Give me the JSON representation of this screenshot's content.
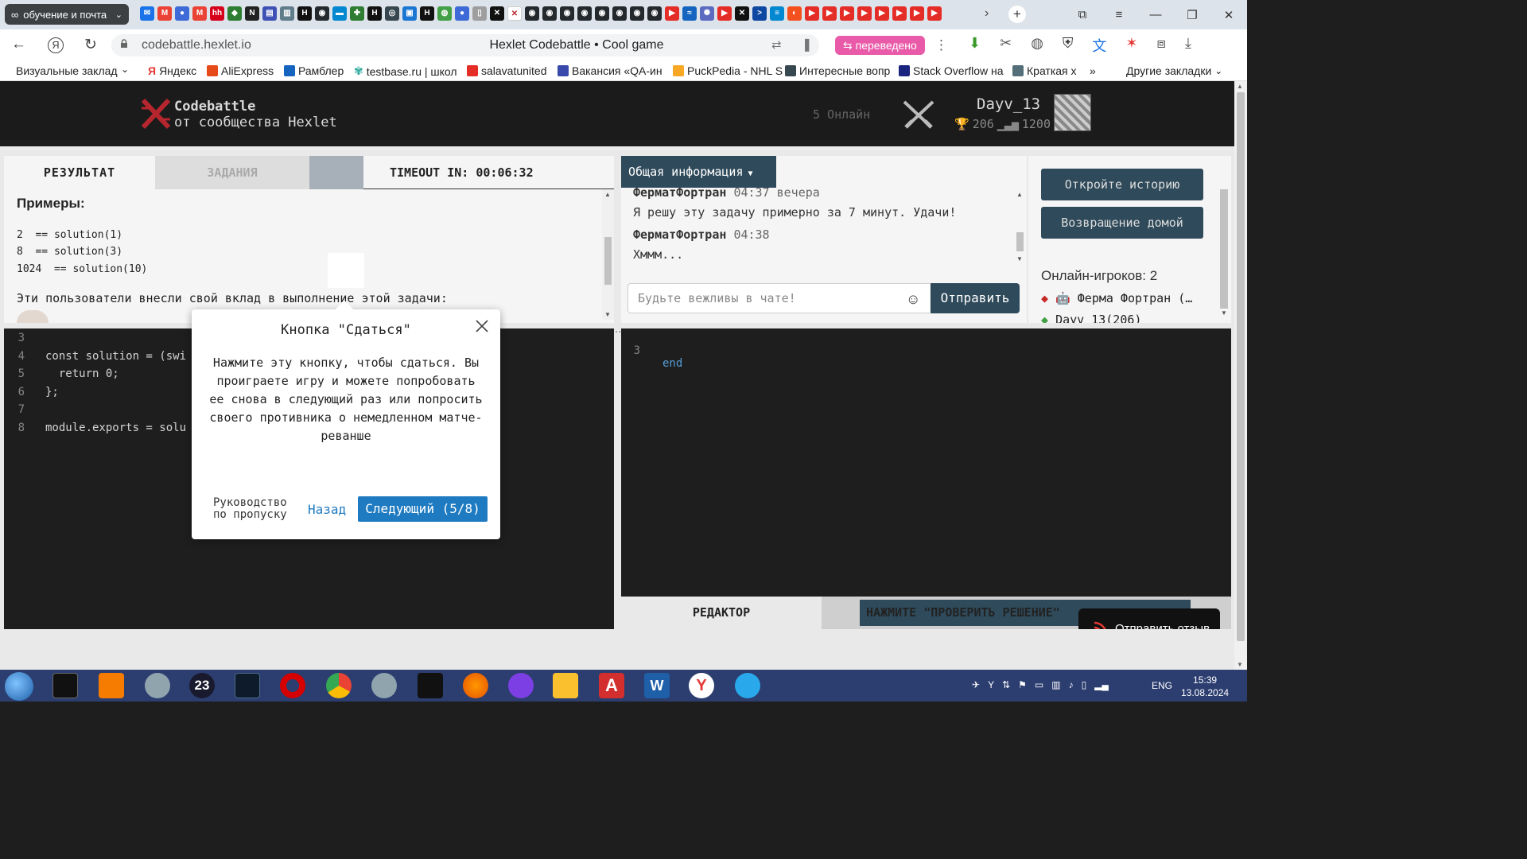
{
  "browser": {
    "tab_group_label": "обучение и почта",
    "url": "codebattle.hexlet.io",
    "page_title": "Hexlet Codebattle • Cool game",
    "translated_badge": "переведено",
    "bookmarks": [
      "Визуальные заклад",
      "Яндекс",
      "AliExpress",
      "Рамблер",
      "testbase.ru | школ",
      "salavatunited",
      "Вакансия «QA-ин",
      "PuckPedia - NHL S",
      "Интересные вопр",
      "Stack Overflow на",
      "Краткая х"
    ],
    "other_bookmarks": "Другие закладки",
    "more_bookmarks": "»"
  },
  "header": {
    "brand_line1": "Codebattle",
    "brand_line2": "от сообщества Hexlet",
    "online": "5 Онлайн",
    "user_name": "Dayv_13",
    "user_rank": "206",
    "user_rating": "1200"
  },
  "task_panel": {
    "tab_result": "РЕЗУЛЬТАТ",
    "tab_tasks": "ЗАДАНИЯ",
    "timeout": "TIMEOUT IN: 00:06:32",
    "examples_title": "Примеры:",
    "examples": [
      "2  == solution(1)",
      "8  == solution(3)",
      "1024  == solution(10)"
    ],
    "contributors": "Эти пользователи внесли свой вклад в выполнение этой задачи:"
  },
  "left_editor": {
    "lines": [
      {
        "n": "3",
        "code": ""
      },
      {
        "n": "4",
        "code": "const solution = (swi"
      },
      {
        "n": "5",
        "code": "  return 0;"
      },
      {
        "n": "6",
        "code": "};"
      },
      {
        "n": "7",
        "code": ""
      },
      {
        "n": "8",
        "code": "module.exports = solu"
      }
    ]
  },
  "chat": {
    "info_button": "Общая информация",
    "messages": [
      {
        "author": "ФерматФортран",
        "time": "04:37 вечера",
        "text": "Я решу эту задачу примерно за 7 минут. Удачи!"
      },
      {
        "author": "ФерматФортран",
        "time": "04:38",
        "text": "Хммм..."
      }
    ],
    "input_placeholder": "Будьте вежливы в чате!",
    "send_label": "Отправить"
  },
  "sidebar": {
    "history_button": "Откройте историю",
    "home_button": "Возвращение домой",
    "online_players_label": "Онлайн-игроков:",
    "online_players_count": "2",
    "players": [
      "Ферма Фортран (…",
      "Dayv_13(206)"
    ]
  },
  "right_editor": {
    "lines": [
      {
        "n": "3",
        "code": "end"
      }
    ],
    "tab_editor": "РЕДАКТОР",
    "check_hint": "НАЖМИТЕ \"ПРОВЕРИТЬ РЕШЕНИЕ\""
  },
  "feedback": {
    "label": "Отправить отзыв"
  },
  "tour_modal": {
    "title": "Кнопка \"Сдаться\"",
    "body": "Нажмите эту кнопку, чтобы сдаться. Вы проиграете игру и можете попробовать ее снова в следующий раз или попросить своего противника о немедленном матче-реванше",
    "skip_label": "Руководство по пропуску",
    "back_label": "Назад",
    "next_label": "Следующий (5/8)"
  },
  "taskbar": {
    "lang": "ENG",
    "time": "15:39",
    "date": "13.08.2024",
    "badge_23": "23"
  },
  "colors": {
    "accent_dark": "#2f4a5a",
    "link_blue": "#1f7bc1",
    "translate_pink": "#e95ba8",
    "logo_red": "#b5262e"
  }
}
